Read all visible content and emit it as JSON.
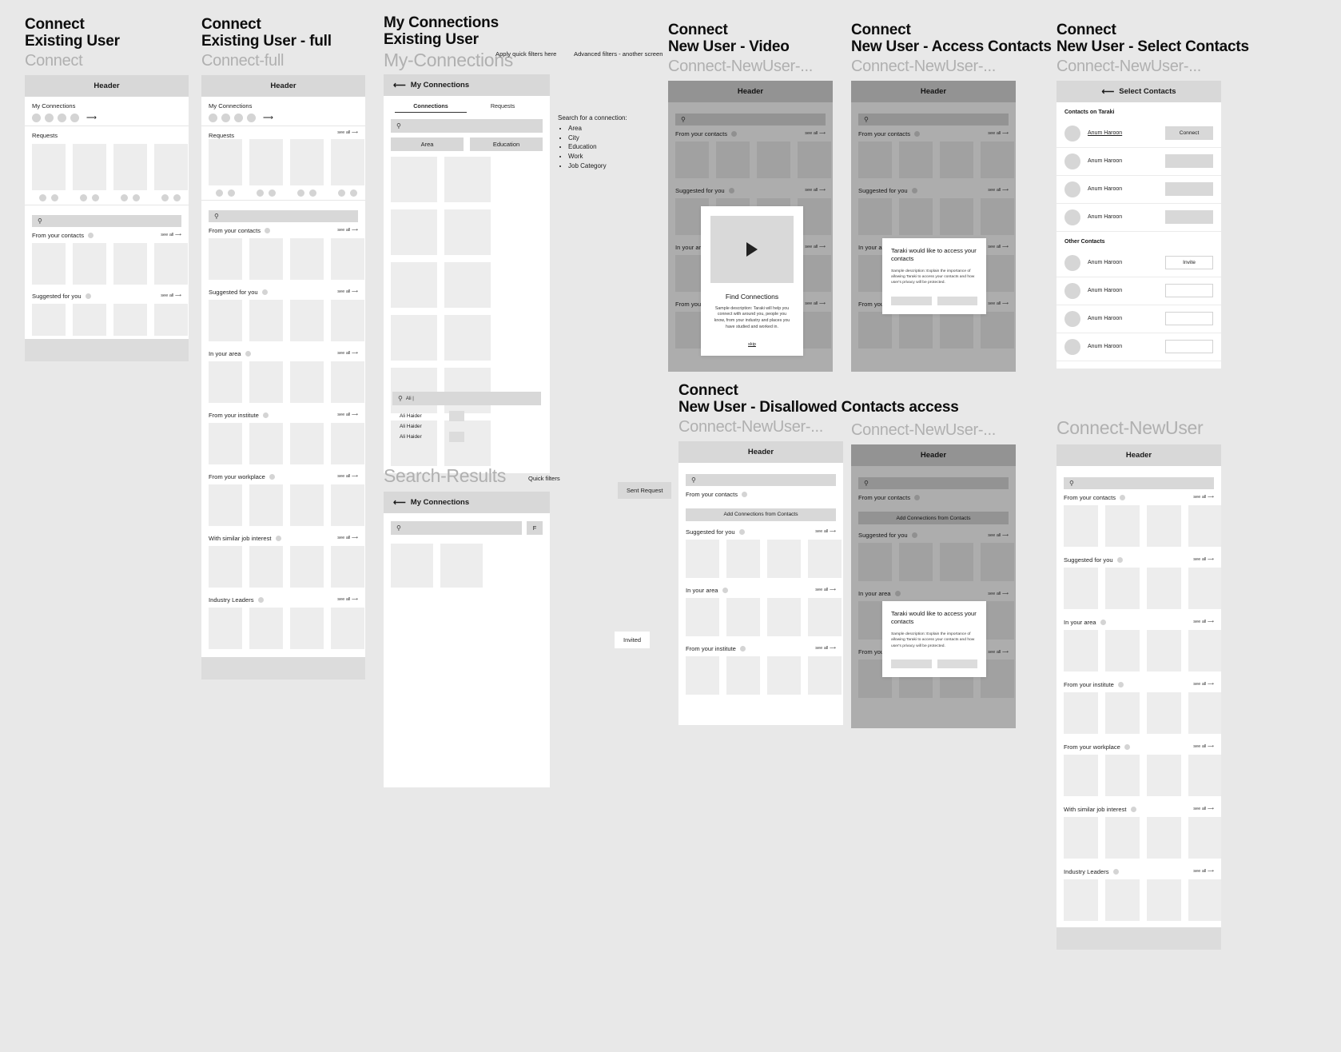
{
  "frames": {
    "f1": {
      "t1": "Connect",
      "t2": "Existing User",
      "sub": "Connect"
    },
    "f2": {
      "t1": "Connect",
      "t2": "Existing User - full",
      "sub": "Connect-full"
    },
    "f3": {
      "t1": "My Connections",
      "t2": "Existing User",
      "sub": "My-Connections"
    },
    "f4": {
      "t1": "Connect",
      "t2": "New User - Video",
      "sub": "Connect-NewUser-..."
    },
    "f5": {
      "t1": "Connect",
      "t2": "New User - Access Contacts",
      "sub": "Connect-NewUser-..."
    },
    "f6": {
      "t1": "Connect",
      "t2": "New User - Select Contacts",
      "sub": "Connect-NewUser-..."
    },
    "f7": {
      "t1": "Connect",
      "t2": "New User - Disallowed Contacts access",
      "sub": "Connect-NewUser-..."
    },
    "f8": {
      "sub": "Connect-NewUser-..."
    },
    "f9": {
      "sub": "Connect-NewUser"
    },
    "f10": {
      "title": "Search-Results",
      "note": "Quick filters"
    }
  },
  "common": {
    "header": "Header",
    "see_all": "see all",
    "arrow_right": "⟶",
    "arrow_left": "⟵",
    "search_icon": "search-icon"
  },
  "sections": {
    "my_connections": "My Connections",
    "requests": "Requests",
    "from_contacts": "From your contacts",
    "suggested": "Suggested for you",
    "in_area": "In your area",
    "from_institute": "From your institute",
    "from_workplace": "From your workplace",
    "similar_job": "With similar job interest",
    "industry_leaders": "Industry Leaders"
  },
  "connections_screen": {
    "header": "My Connections",
    "tabs": [
      {
        "label": "Connections",
        "active": true
      },
      {
        "label": "Requests",
        "active": false
      }
    ],
    "chips": [
      "Area",
      "Education"
    ],
    "search_placeholder": ""
  },
  "annotations": {
    "quick_filters_here": "Apply quick filters here",
    "advanced_filters": "Advanced filters - another screen",
    "search_for_connection": "Search for a connection:",
    "search_criteria": [
      "Area",
      "City",
      "Education",
      "Work",
      "Job Category"
    ],
    "quick_filters": "Quick filters"
  },
  "search_demo": {
    "query": "Ali |",
    "results": [
      "Ali Haider",
      "Ali Haider",
      "Ali Haider"
    ]
  },
  "search_results_screen": {
    "header": "My Connections",
    "filter_button": "F"
  },
  "pills": {
    "sent_request": "Sent Request",
    "invited": "Invited"
  },
  "video_modal": {
    "title": "Find Connections",
    "description": "Sample description: Taraki will help you connect with around you, people you know, from your industry and places you have studied and worked in.",
    "skip": "skip",
    "play_icon": "play-icon"
  },
  "contacts_modal": {
    "title": "Taraki would like to access your contacts",
    "description": "Sample description: Explain the importance of allowing Taraki to access your contacts and how user's privacy will be protected."
  },
  "select_contacts_screen": {
    "header": "Select Contacts",
    "group_on_taraki": "Contacts on Taraki",
    "group_other": "Other Contacts",
    "on_taraki": [
      {
        "name": "Anum Haroon",
        "action": "Connect",
        "style": "solid"
      },
      {
        "name": "Anum Haroon",
        "action": "",
        "style": "blank"
      },
      {
        "name": "Anum Haroon",
        "action": "",
        "style": "blank"
      },
      {
        "name": "Anum Haroon",
        "action": "",
        "style": "blank"
      }
    ],
    "other": [
      {
        "name": "Anum Haroon",
        "action": "Invite",
        "style": "outline"
      },
      {
        "name": "Anum Haroon",
        "action": "",
        "style": "outline"
      },
      {
        "name": "Anum Haroon",
        "action": "",
        "style": "outline"
      },
      {
        "name": "Anum Haroon",
        "action": "",
        "style": "outline"
      }
    ]
  },
  "disallowed_screen": {
    "add_connections_button": "Add Connections from Contacts"
  }
}
